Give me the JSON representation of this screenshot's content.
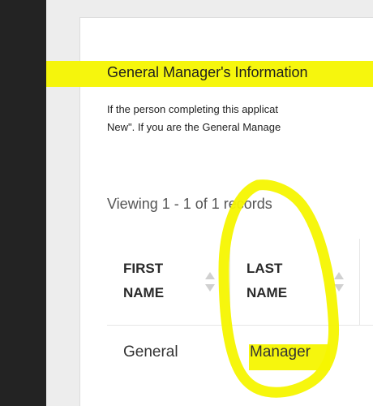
{
  "section": {
    "title": "General Manager's Information",
    "intro_line1": "If the person completing this applicat",
    "intro_line2": "New\". If you are the General Manage"
  },
  "list": {
    "record_count": "Viewing 1 - 1 of 1 records"
  },
  "table": {
    "columns": [
      {
        "label": "FIRST NAME",
        "sortable": true
      },
      {
        "label": "LAST NAME",
        "sortable": true
      }
    ],
    "rows": [
      {
        "first": "General",
        "last": "Manager"
      }
    ]
  },
  "annotation": {
    "highlight_color": "#f6f600",
    "circle_color": "#f6f600"
  }
}
